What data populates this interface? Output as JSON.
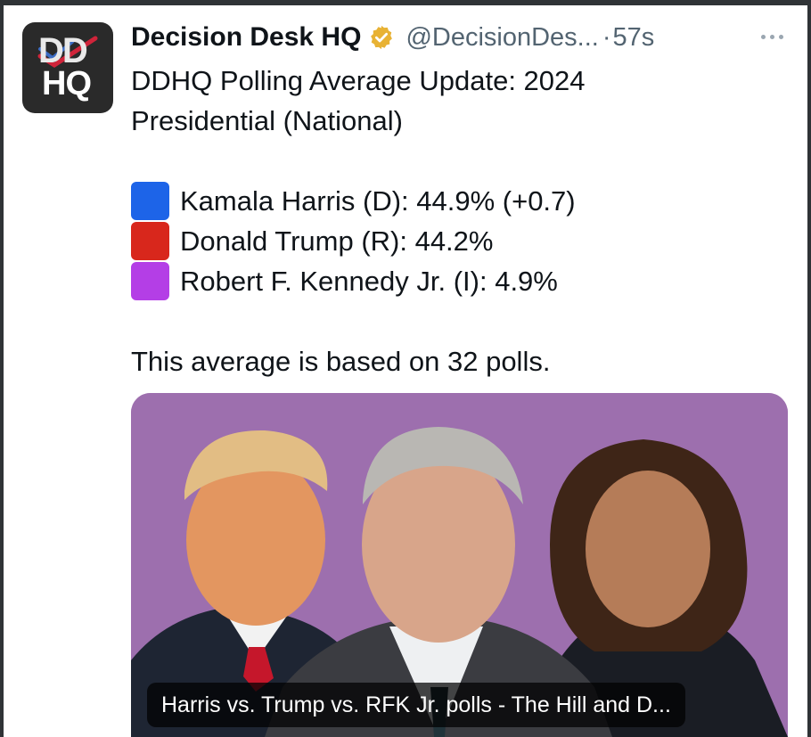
{
  "tweet": {
    "author_name": "Decision Desk HQ",
    "handle": "@DecisionDes...",
    "separator": "·",
    "time": "57s",
    "verified_icon": "verified-badge-gold",
    "more_icon": "more-horizontal-icon",
    "avatar_text_top": "DD",
    "avatar_text_bottom": "HQ",
    "text": {
      "title_line1": "DDHQ Polling Average Update: 2024",
      "title_line2": "Presidential (National)",
      "candidates": [
        {
          "label": "Kamala Harris (D): 44.9% (+0.7)",
          "square_color": "#1d64e8",
          "square_icon": "blue-square-emoji"
        },
        {
          "label": "Donald Trump (R): 44.2%",
          "square_color": "#d8271c",
          "square_icon": "red-square-emoji"
        },
        {
          "label": "Robert F. Kennedy Jr. (I): 4.9%",
          "square_color": "#b43ee6",
          "square_icon": "purple-square-emoji"
        }
      ],
      "footer": "This average is based on 32 polls."
    },
    "media": {
      "background_color": "#9d6fae",
      "caption": "Harris vs. Trump vs. RFK Jr. polls - The Hill and D..."
    }
  }
}
